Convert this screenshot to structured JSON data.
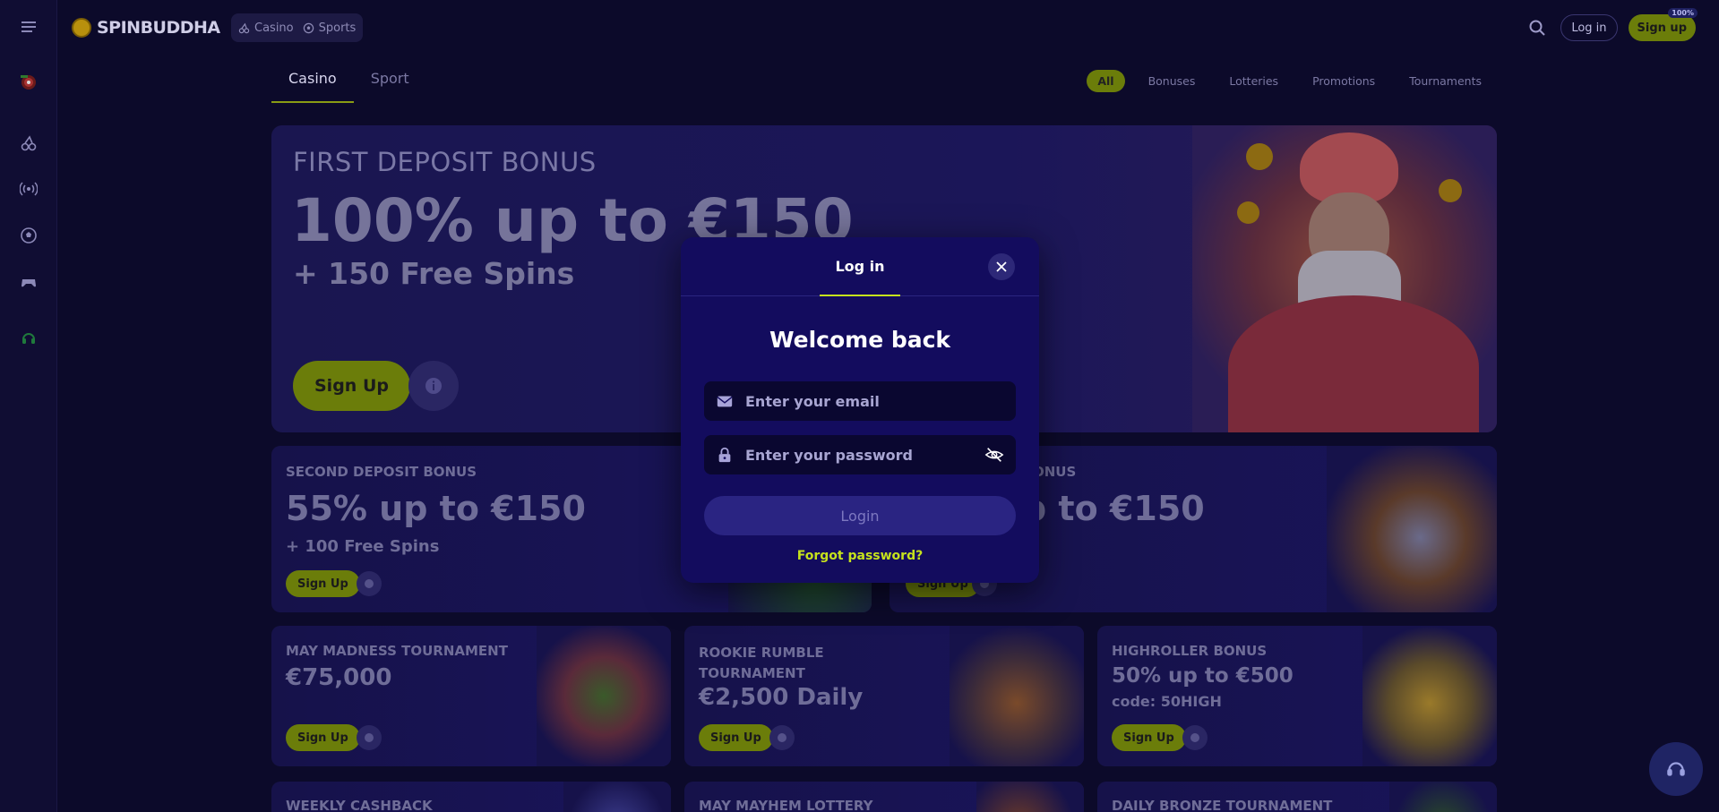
{
  "brand": {
    "name": "SPINBUDDHA"
  },
  "nav_switch": {
    "casino": "Casino",
    "sports": "Sports"
  },
  "header": {
    "login": "Log in",
    "signup": "Sign up",
    "signup_badge": "100%"
  },
  "tabs": [
    {
      "label": "Casino",
      "active": true
    },
    {
      "label": "Sport",
      "active": false
    }
  ],
  "filters": [
    "All",
    "Bonuses",
    "Lotteries",
    "Promotions",
    "Tournaments"
  ],
  "hero": {
    "eyebrow": "FIRST DEPOSIT BONUS",
    "headline": "100% up to €150",
    "sub": "+ 150 Free Spins",
    "cta": "Sign Up"
  },
  "cards": [
    {
      "title": "SECOND DEPOSIT BONUS",
      "big": "55% up to €150",
      "sub": "+ 100 Free Spins",
      "cta": "Sign Up"
    },
    {
      "title": "ONUS",
      "big": "p to €150",
      "sub": "",
      "cta": "Sign Up"
    },
    {
      "title": "MAY MADNESS TOURNAMENT",
      "big": "€75,000",
      "sub": "",
      "cta": "Sign Up"
    },
    {
      "title": "ROOKIE RUMBLE TOURNAMENT",
      "big": "€2,500 Daily",
      "sub": "",
      "cta": "Sign Up"
    },
    {
      "title": "HIGHROLLER BONUS",
      "big": "50% up to €500",
      "sub": "code: 50HIGH",
      "cta": "Sign Up"
    },
    {
      "title": "WEEKLY CASHBACK",
      "big": "",
      "sub": "",
      "cta": ""
    },
    {
      "title": "MAY MAYHEM LOTTERY",
      "big": "",
      "sub": "",
      "cta": ""
    },
    {
      "title": "DAILY BRONZE TOURNAMENT",
      "big": "",
      "sub": "",
      "cta": ""
    }
  ],
  "modal": {
    "tab": "Log in",
    "welcome": "Welcome back",
    "email_placeholder": "Enter your email",
    "password_placeholder": "Enter your password",
    "login": "Login",
    "forgot": "Forgot password?"
  },
  "icons": {
    "rail": [
      "menu-icon",
      "logo-target-icon",
      "cherry-icon",
      "live-icon",
      "soccer-icon",
      "gamepad-icon",
      "headset-icon"
    ]
  },
  "colors": {
    "accent": "#c6e21c",
    "accent_dim": "#6b7d0a",
    "bg": "#0c0a2a",
    "modal": "#130c5e"
  }
}
